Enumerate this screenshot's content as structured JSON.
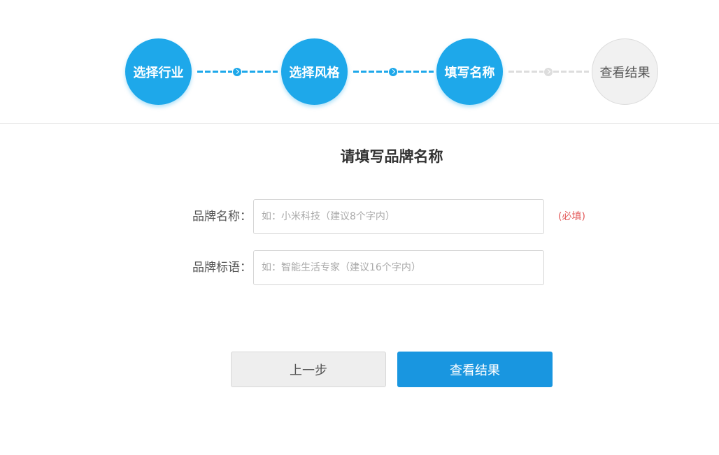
{
  "stepper": {
    "steps": [
      {
        "label": "选择行业",
        "state": "done"
      },
      {
        "label": "选择风格",
        "state": "done"
      },
      {
        "label": "填写名称",
        "state": "current"
      },
      {
        "label": "查看结果",
        "state": "pending"
      }
    ],
    "active_color": "#1ea8ea",
    "pending_color": "#dddddd"
  },
  "form": {
    "title": "请填写品牌名称",
    "brand_name": {
      "label": "品牌名称：",
      "placeholder": "如：小米科技（建议8个字内）",
      "value": "",
      "required_hint": "(必填)"
    },
    "brand_slogan": {
      "label": "品牌标语：",
      "placeholder": "如：智能生活专家（建议16个字内）",
      "value": ""
    }
  },
  "buttons": {
    "prev_label": "上一步",
    "next_label": "查看结果",
    "next_color": "#1996e0"
  }
}
